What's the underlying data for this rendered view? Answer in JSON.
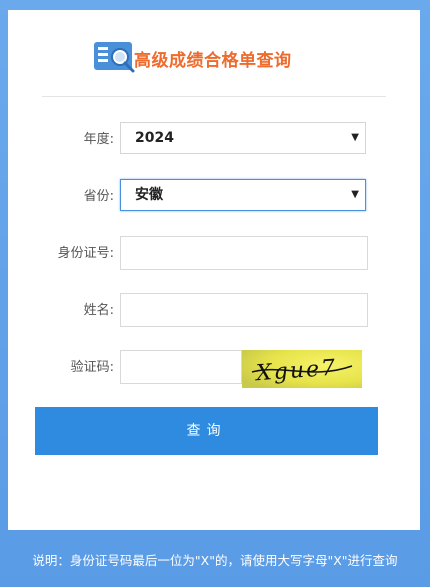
{
  "header": {
    "title": "高级成绩合格单查询",
    "logo_icon": "document-search-icon"
  },
  "form": {
    "year": {
      "label": "年度:",
      "value": "2024"
    },
    "province": {
      "label": "省份:",
      "value": "安徽"
    },
    "id_number": {
      "label": "身份证号:",
      "value": ""
    },
    "name": {
      "label": "姓名:",
      "value": ""
    },
    "captcha": {
      "label": "验证码:",
      "value": "",
      "image_text": "Xgue7"
    }
  },
  "query_button": {
    "label": "查询"
  },
  "footer": {
    "note": "说明：身份证号码最后一位为\"X\"的，请使用大写字母\"X\"进行查询"
  },
  "colors": {
    "accent": "#2e8be0",
    "title": "#ef6b2d",
    "background": "#5a9be6"
  }
}
